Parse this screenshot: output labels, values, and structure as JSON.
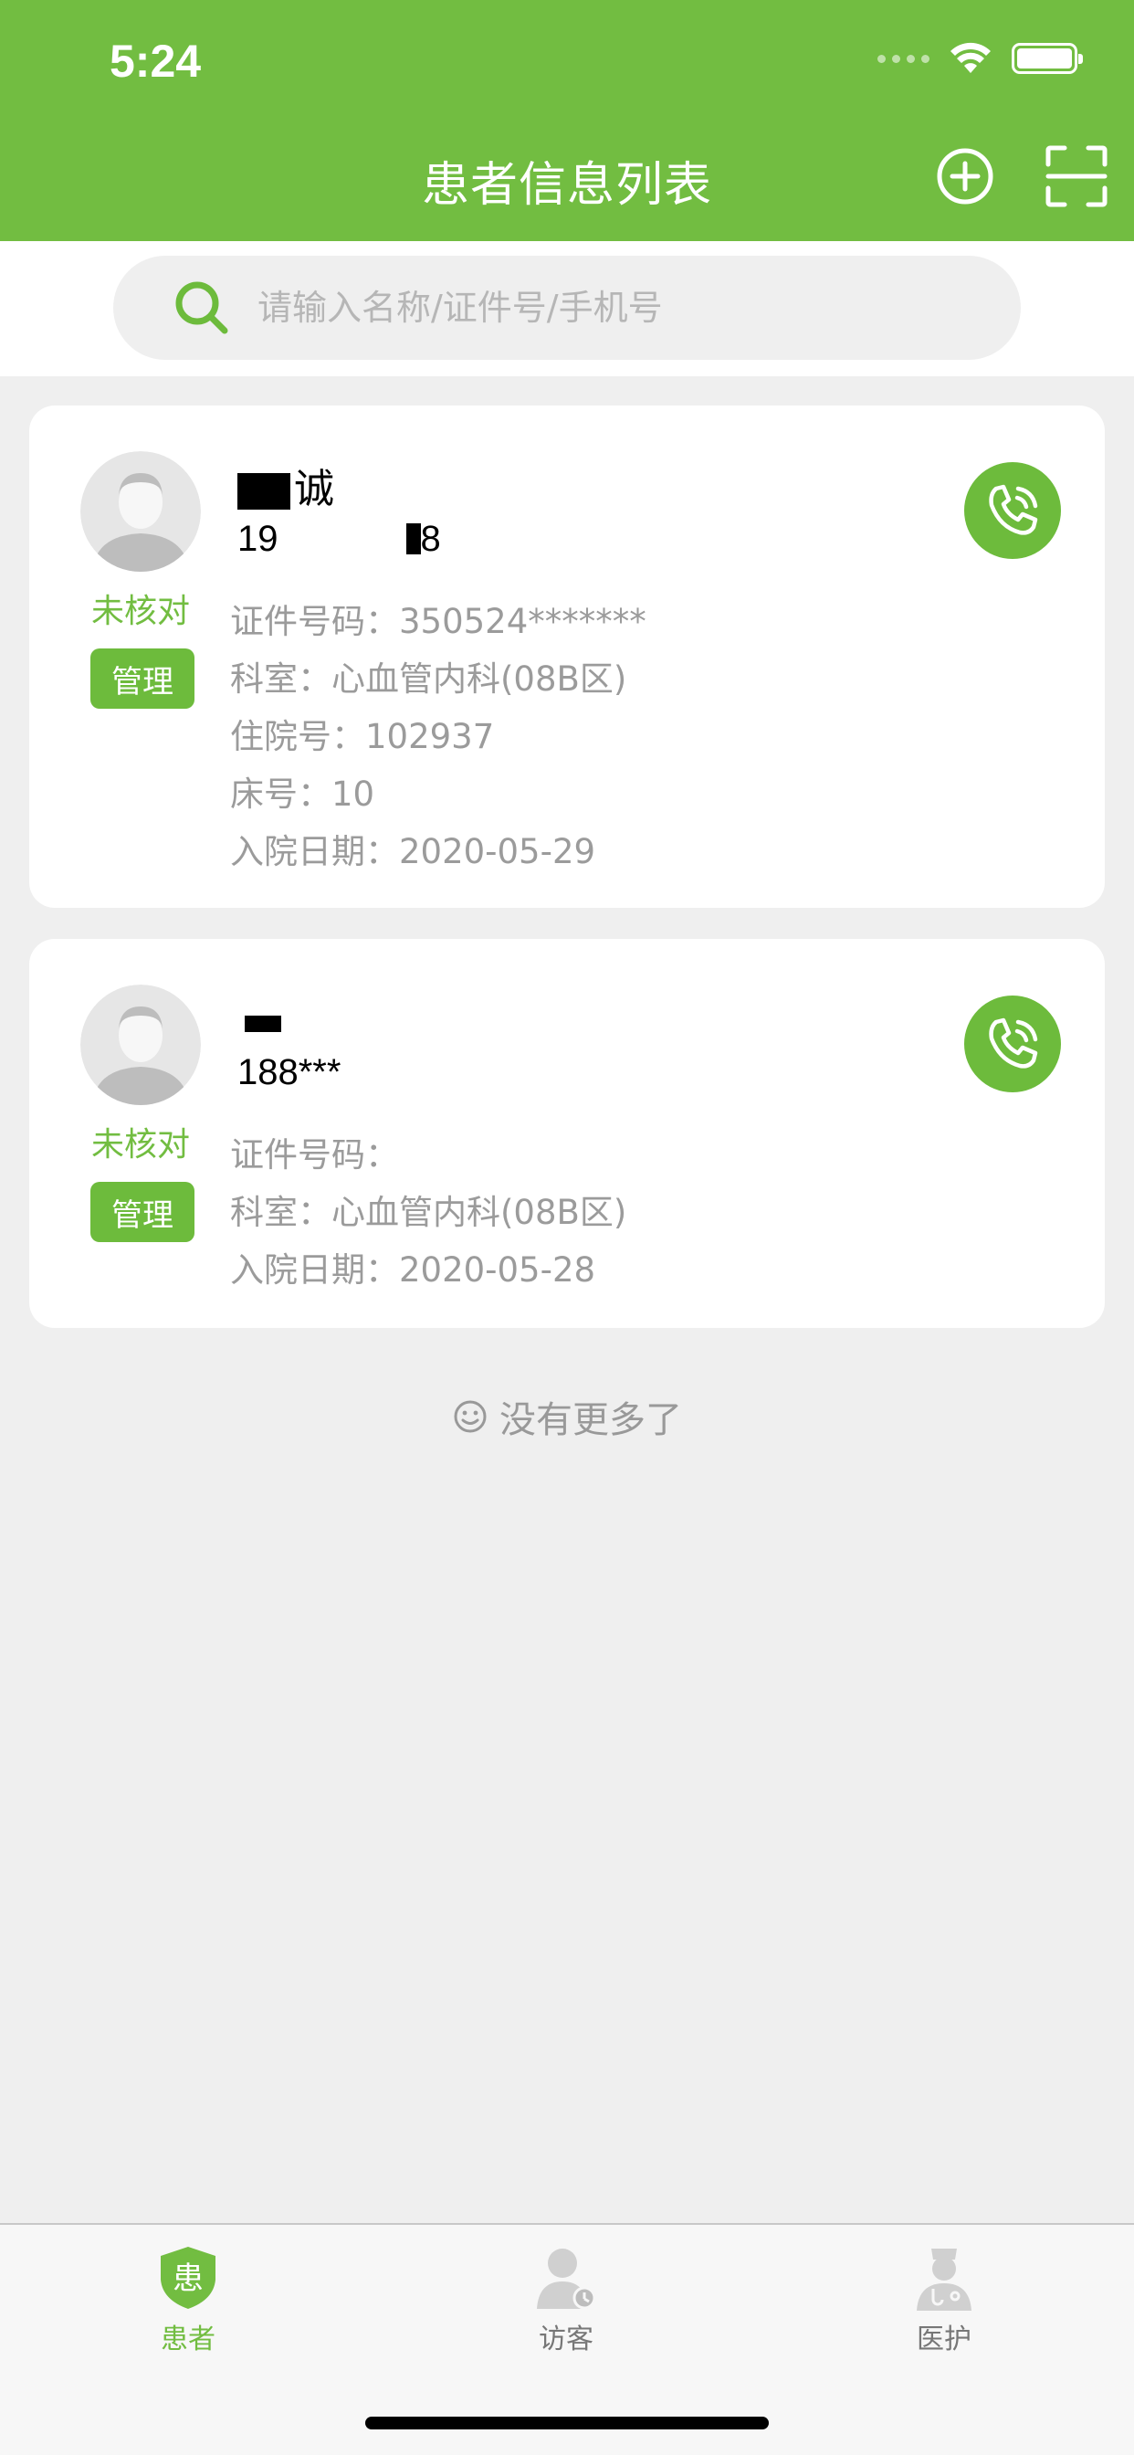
{
  "status_bar": {
    "time": "5:24"
  },
  "header": {
    "title": "患者信息列表"
  },
  "search": {
    "placeholder": "请输入名称/证件号/手机号"
  },
  "patients": [
    {
      "name": "诚",
      "phone_partial_start": "19",
      "phone_partial_end": "8",
      "verify_status": "未核对",
      "manage_label": "管理",
      "id_line": "证件号码：350524*******",
      "dept_line": "科室：心血管内科(08B区)",
      "inpatient_line": "住院号：102937",
      "bed_line": "床号：10",
      "admit_line": "入院日期：2020-05-29"
    },
    {
      "phone": "188***",
      "verify_status": "未核对",
      "manage_label": "管理",
      "id_line": "证件号码：",
      "dept_line": "科室：心血管内科(08B区)",
      "admit_line": "入院日期：2020-05-28"
    }
  ],
  "list_footer": {
    "text": "没有更多了"
  },
  "tabbar": {
    "items": [
      {
        "label": "患者",
        "icon": "patient-icon",
        "icon_char": "患",
        "active": true
      },
      {
        "label": "访客",
        "icon": "visitor-icon",
        "active": false
      },
      {
        "label": "医护",
        "icon": "medical-staff-icon",
        "active": false
      }
    ]
  },
  "colors": {
    "primary": "#72bd41",
    "background": "#efefef"
  }
}
